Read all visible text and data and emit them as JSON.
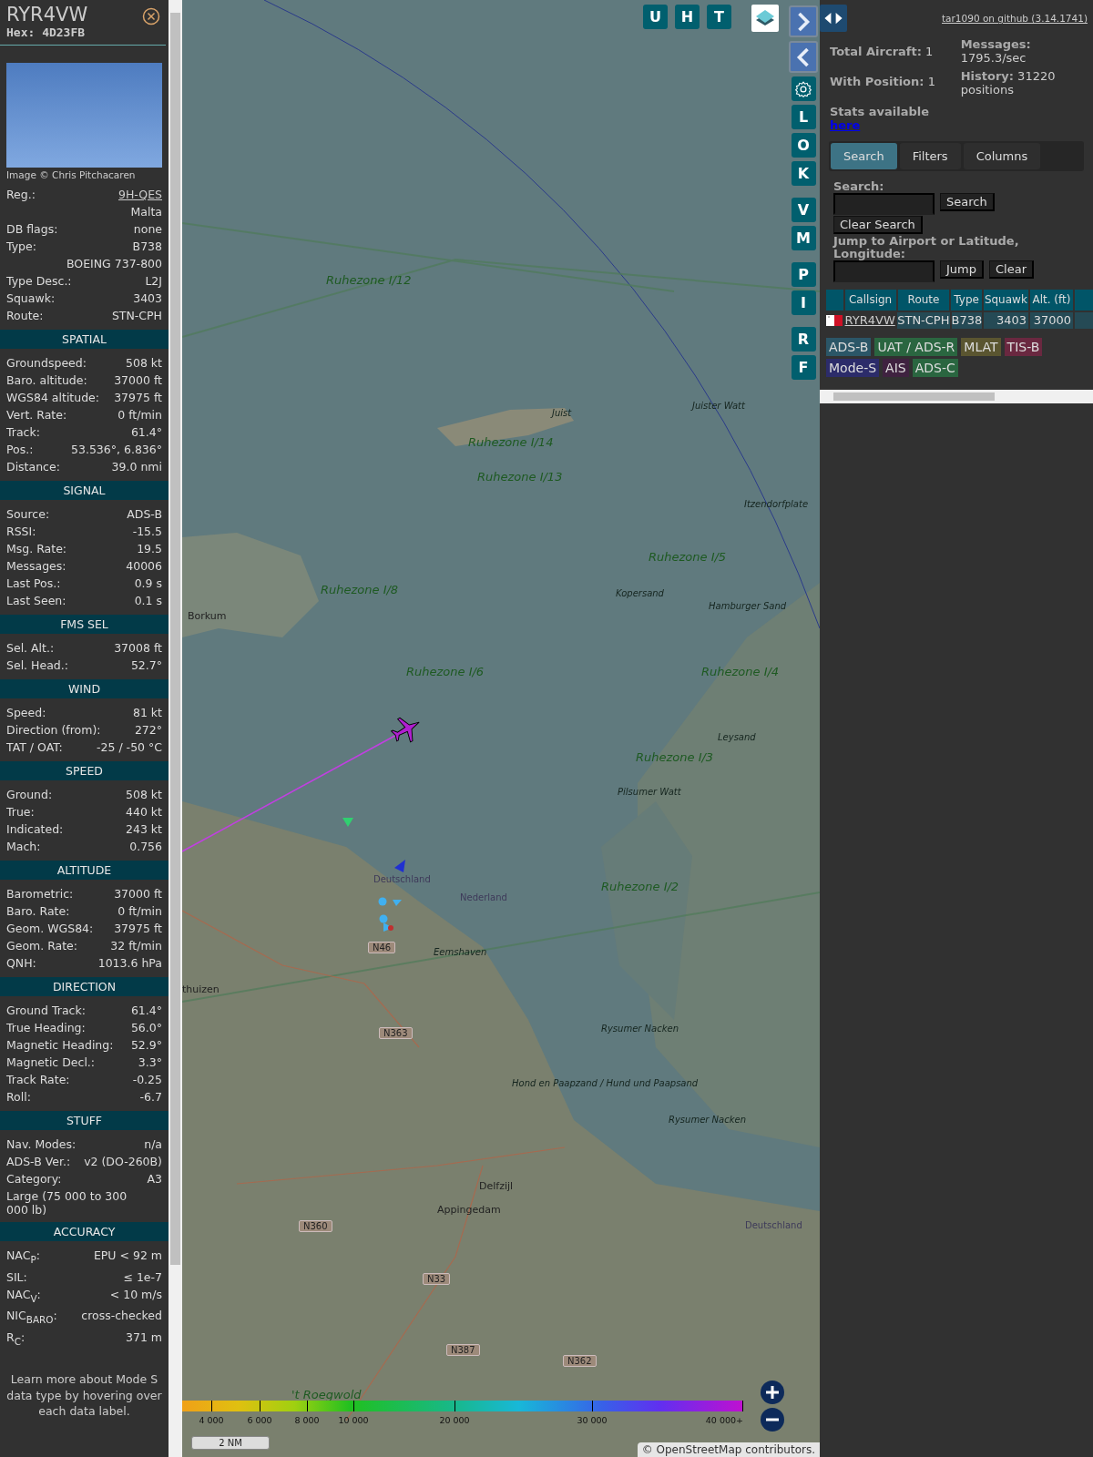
{
  "sidebar": {
    "callsign": "RYR4VW",
    "hex_label": "Hex:",
    "hex": "4D23FB",
    "photo_credit": "Image © Chris Pitchacaren",
    "details": [
      {
        "kind": "link",
        "label": "Reg.:",
        "value": "9H-QES"
      },
      {
        "kind": "note",
        "value": "Malta"
      },
      {
        "kind": "row",
        "label": "DB flags:",
        "value": "none"
      },
      {
        "kind": "row",
        "label": "Type:",
        "value": "B738"
      },
      {
        "kind": "note",
        "value": "BOEING 737-800"
      },
      {
        "kind": "row",
        "label": "Type Desc.:",
        "value": "L2J"
      },
      {
        "kind": "row",
        "label": "Squawk:",
        "value": "3403"
      },
      {
        "kind": "row",
        "label": "Route:",
        "value": "STN-CPH"
      }
    ],
    "sections": [
      {
        "title": "SPATIAL",
        "rows": [
          {
            "kind": "row",
            "label": "Groundspeed:",
            "value": "508 kt"
          },
          {
            "kind": "row",
            "label": "Baro. altitude:",
            "value": "37000 ft"
          },
          {
            "kind": "row",
            "label": "WGS84 altitude:",
            "value": "37975 ft"
          },
          {
            "kind": "row",
            "label": "Vert. Rate:",
            "value": "0 ft/min"
          },
          {
            "kind": "row",
            "label": "Track:",
            "value": "61.4°"
          },
          {
            "kind": "row",
            "label": "Pos.:",
            "value": "53.536°, 6.836°"
          },
          {
            "kind": "row",
            "label": "Distance:",
            "value": "39.0 nmi"
          }
        ]
      },
      {
        "title": "SIGNAL",
        "rows": [
          {
            "kind": "row",
            "label": "Source:",
            "value": "ADS-B"
          },
          {
            "kind": "row",
            "label": "RSSI:",
            "value": "-15.5"
          },
          {
            "kind": "row",
            "label": "Msg. Rate:",
            "value": "19.5"
          },
          {
            "kind": "row",
            "label": "Messages:",
            "value": "40006"
          },
          {
            "kind": "row",
            "label": "Last Pos.:",
            "value": "0.9 s"
          },
          {
            "kind": "row",
            "label": "Last Seen:",
            "value": "0.1 s"
          }
        ]
      },
      {
        "title": "FMS SEL",
        "rows": [
          {
            "kind": "row",
            "label": "Sel. Alt.:",
            "value": "37008 ft"
          },
          {
            "kind": "row",
            "label": "Sel. Head.:",
            "value": "52.7°"
          }
        ]
      },
      {
        "title": "WIND",
        "rows": [
          {
            "kind": "row",
            "label": "Speed:",
            "value": "81 kt"
          },
          {
            "kind": "row",
            "label": "Direction (from):",
            "value": "272°"
          },
          {
            "kind": "row",
            "label": "TAT / OAT:",
            "value": "-25 / -50 °C"
          }
        ]
      },
      {
        "title": "SPEED",
        "rows": [
          {
            "kind": "row",
            "label": "Ground:",
            "value": "508 kt"
          },
          {
            "kind": "row",
            "label": "True:",
            "value": "440 kt"
          },
          {
            "kind": "row",
            "label": "Indicated:",
            "value": "243 kt"
          },
          {
            "kind": "row",
            "label": "Mach:",
            "value": "0.756"
          }
        ]
      },
      {
        "title": "ALTITUDE",
        "rows": [
          {
            "kind": "row",
            "label": "Barometric:",
            "value": "37000 ft"
          },
          {
            "kind": "row",
            "label": "Baro. Rate:",
            "value": "0 ft/min"
          },
          {
            "kind": "row",
            "label": "Geom. WGS84:",
            "value": "37975 ft"
          },
          {
            "kind": "row",
            "label": "Geom. Rate:",
            "value": "32 ft/min"
          },
          {
            "kind": "row",
            "label": "QNH:",
            "value": "1013.6 hPa"
          }
        ]
      },
      {
        "title": "DIRECTION",
        "rows": [
          {
            "kind": "row",
            "label": "Ground Track:",
            "value": "61.4°"
          },
          {
            "kind": "row",
            "label": "True Heading:",
            "value": "56.0°"
          },
          {
            "kind": "row",
            "label": "Magnetic Heading:",
            "value": "52.9°"
          },
          {
            "kind": "row",
            "label": "Magnetic Decl.:",
            "value": "3.3°"
          },
          {
            "kind": "row",
            "label": "Track Rate:",
            "value": "-0.25"
          },
          {
            "kind": "row",
            "label": "Roll:",
            "value": "-6.7"
          }
        ]
      },
      {
        "title": "STUFF",
        "rows": [
          {
            "kind": "row",
            "label": "Nav. Modes:",
            "value": "n/a"
          },
          {
            "kind": "row",
            "label": "ADS-B Ver.:",
            "value": "v2 (DO-260B)"
          },
          {
            "kind": "row",
            "label": "Category:",
            "value": "A3"
          },
          {
            "kind": "text",
            "value": "Large (75 000 to 300 000 lb)"
          }
        ]
      },
      {
        "title": "ACCURACY",
        "rows": [
          {
            "kind": "row",
            "label": "NAC$_{P}$:",
            "value": "EPU < 92 m"
          },
          {
            "kind": "row",
            "label": "SIL:",
            "value": "≤ 1e-7"
          },
          {
            "kind": "row",
            "label": "NAC$_{V}$:",
            "value": "< 10 m/s"
          },
          {
            "kind": "row",
            "label": "NIC$_{BARO}$:",
            "value": "cross-checked"
          },
          {
            "kind": "row",
            "label": "R$_{C}$:",
            "value": "371 m"
          }
        ]
      }
    ],
    "footer": "Learn more about Mode S data type by hovering over each data label."
  },
  "map": {
    "top_buttons": [
      {
        "kind": "letter",
        "label": "U"
      },
      {
        "kind": "letter",
        "label": "H"
      },
      {
        "kind": "letter",
        "label": "T"
      },
      {
        "kind": "layers"
      }
    ],
    "side_buttons": [
      {
        "kind": "next"
      },
      {
        "kind": "prev"
      },
      {
        "kind": "settings"
      },
      {
        "kind": "letter",
        "label": "L"
      },
      {
        "kind": "letter",
        "label": "O"
      },
      {
        "kind": "letter",
        "label": "K"
      },
      {
        "kind": "letter",
        "label": "V"
      },
      {
        "kind": "letter",
        "label": "M"
      },
      {
        "kind": "letter",
        "label": "P"
      },
      {
        "kind": "letter",
        "label": "I"
      },
      {
        "kind": "letter",
        "label": "R"
      },
      {
        "kind": "letter",
        "label": "F"
      }
    ],
    "labels": [
      {
        "kind": "zone",
        "text": "Ruhezone I/12"
      },
      {
        "kind": "place",
        "text": "Juist"
      },
      {
        "kind": "place",
        "text": "Juister Watt"
      },
      {
        "kind": "zone",
        "text": "Ruhezone I/14"
      },
      {
        "kind": "zone",
        "text": "Ruhezone I/13"
      },
      {
        "kind": "place",
        "text": "Itzendorfplate"
      },
      {
        "kind": "zone",
        "text": "Ruhezone I/5"
      },
      {
        "kind": "place",
        "text": "Kopersand"
      },
      {
        "kind": "zone",
        "text": "Ruhezone I/8"
      },
      {
        "kind": "town",
        "text": "Borkum"
      },
      {
        "kind": "place",
        "text": "Hamburger Sand"
      },
      {
        "kind": "zone",
        "text": "Ruhezone I/6"
      },
      {
        "kind": "zone",
        "text": "Ruhezone I/4"
      },
      {
        "kind": "place",
        "text": "Leysand"
      },
      {
        "kind": "zone",
        "text": "Ruhezone I/3"
      },
      {
        "kind": "place",
        "text": "Pilsumer Watt"
      },
      {
        "kind": "border",
        "text": "Deutschland"
      },
      {
        "kind": "border",
        "text": "Nederland"
      },
      {
        "kind": "zone",
        "text": "Ruhezone I/2"
      },
      {
        "kind": "road",
        "text": "N46"
      },
      {
        "kind": "place",
        "text": "Eemshaven"
      },
      {
        "kind": "town",
        "text": "thuizen"
      },
      {
        "kind": "road",
        "text": "N363"
      },
      {
        "kind": "place",
        "text": "Rysumer Nacken"
      },
      {
        "kind": "place",
        "text": "Hond en Paapzand / Hund und Paapsand"
      },
      {
        "kind": "place",
        "text": "Rysumer Nacken"
      },
      {
        "kind": "town",
        "text": "Delfzijl"
      },
      {
        "kind": "town",
        "text": "Appingedam"
      },
      {
        "kind": "road",
        "text": "N360"
      },
      {
        "kind": "border",
        "text": "Deutschland"
      },
      {
        "kind": "road",
        "text": "N33"
      },
      {
        "kind": "road",
        "text": "N387"
      },
      {
        "kind": "road",
        "text": "N362"
      },
      {
        "kind": "zone",
        "text": "'t Roegwold"
      }
    ],
    "legend_ticks": [
      "4 000",
      "6 000",
      "8 000",
      "10 000",
      "20 000",
      "30 000",
      "40 000+"
    ],
    "scale": "2 NM",
    "attribution": "© OpenStreetMap contributors."
  },
  "panel": {
    "link": "tar1090 on github (3.14.1741)",
    "stats_left": [
      {
        "label": "Total Aircraft:",
        "value": "1"
      },
      {
        "label": "With Position:",
        "value": "1"
      }
    ],
    "stats_right": [
      {
        "label": "Messages:",
        "value": "1795.3/sec"
      },
      {
        "label": "History:",
        "value": "31220 positions"
      }
    ],
    "stats_note": "Stats available",
    "stats_link": "here",
    "tabs": [
      {
        "label": "Search",
        "selected": true
      },
      {
        "label": "Filters",
        "selected": false
      },
      {
        "label": "Columns",
        "selected": false
      }
    ],
    "search_label": "Search:",
    "search_button": "Search",
    "clear_search_button": "Clear Search",
    "jump_label": "Jump to Airport or Latitude, Longitude:",
    "jump_button": "Jump",
    "clear_button": "Clear",
    "columns": [
      "Callsign",
      "Route",
      "Type",
      "Squawk",
      "Alt. (ft)"
    ],
    "rows": [
      {
        "cells": [
          "RYR4VW",
          "STN-CPH",
          "B738",
          "3403",
          "37000"
        ]
      }
    ],
    "sources": [
      {
        "label": "ADS-B",
        "color": "#2b5667"
      },
      {
        "label": "UAT / ADS-R",
        "color": "#2a6640"
      },
      {
        "label": "MLAT",
        "color": "#5a5530"
      },
      {
        "label": "TIS-B",
        "color": "#6a2840"
      },
      {
        "label": "Mode-S",
        "color": "#2c2c6a"
      },
      {
        "label": "AIS",
        "color": "#3f2240"
      },
      {
        "label": "ADS-C",
        "color": "#2a6640"
      }
    ]
  }
}
